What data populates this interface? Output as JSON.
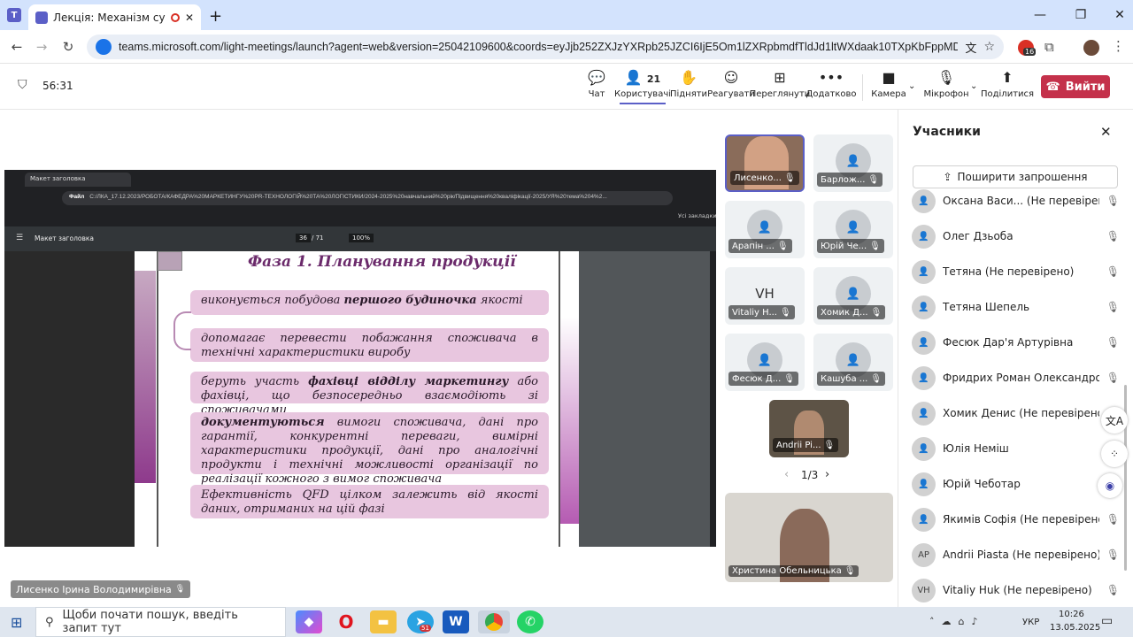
{
  "browser": {
    "tab_title": "Лекція: Механізм сучасног",
    "url": "teams.microsoft.com/light-meetings/launch?agent=web&version=25042109600&coords=eyJjb252ZXJzYXRpb25JZCI6IjE5Om1lZXRpbmdfTldJd1ltWXdaak10TXpKbFppMDBZemcyTF...",
    "ext_badge": "16"
  },
  "meeting": {
    "timer": "56:31",
    "toolbar": [
      {
        "label": "Чат",
        "icon": "chat-icon"
      },
      {
        "label": "Користувачі",
        "icon": "people-icon",
        "count": "21"
      },
      {
        "label": "Підняти",
        "icon": "hand-icon"
      },
      {
        "label": "Реагувати",
        "icon": "smiley-icon"
      },
      {
        "label": "Переглянути",
        "icon": "grid-icon"
      },
      {
        "label": "Додатково",
        "icon": "more-icon"
      },
      {
        "label": "Камера",
        "icon": "camera-icon"
      },
      {
        "label": "Мікрофон",
        "icon": "mic-off-icon"
      },
      {
        "label": "Поділитися",
        "icon": "share-icon"
      }
    ],
    "leave_label": "Вийти",
    "presenter_label": "Лисенко Ірина Володимирівна"
  },
  "pdf": {
    "tab_title": "Макет заголовка",
    "file_chip": "Файл",
    "path": "C:/ЛКА_17.12.2023/РОБОТА/КАФЕДРА%20МАРКЕТИНГУ%20PR-ТЕХНОЛОГІЙ%20ТА%20ЛОГІСТИКИ/2024-2025%20навчальний%20рік/Підвищення%20кваліфікації-2025/УЯ%20тема%204%2...",
    "bookmarks": "Усі закладки",
    "doc_title": "Макет заголовка",
    "page_current": "36",
    "page_total": "/ 71",
    "zoom": "100%",
    "slide_title": "Фаза 1. Планування продукції",
    "items": [
      {
        "pre": "виконується побудова ",
        "bold": "першого будиночка",
        "post": " якості"
      },
      {
        "pre": "допомагає перевести побажання споживача в технічні характеристики виробу",
        "bold": "",
        "post": ""
      },
      {
        "pre": "беруть участь ",
        "bold": "фахівці відділу маркетингу",
        "post": " або фахівці, що безпосередньо взаємодіють зі споживачами"
      },
      {
        "pre": "",
        "bold": "документуються",
        "post": " вимоги споживача, дані про гарантії, конкурентні переваги, вимірні характеристики продукції, дані про аналогічні продукти і технічні можливості організації по реалізації кожного з вимог споживача"
      },
      {
        "pre": "Ефективність QFD цілком залежить від якості даних, отриманих на цій фазі",
        "bold": "",
        "post": ""
      }
    ]
  },
  "gallery": {
    "tiles": [
      {
        "name": "Лисенко...",
        "initials": ""
      },
      {
        "name": "Барлож...",
        "initials": ""
      },
      {
        "name": "Арапін ...",
        "initials": ""
      },
      {
        "name": "Юрій Че...",
        "initials": ""
      },
      {
        "name": "Vitaliy H...",
        "initials": "VH"
      },
      {
        "name": "Хомик Д...",
        "initials": ""
      },
      {
        "name": "Фесюк Д...",
        "initials": ""
      },
      {
        "name": "Кашуба ...",
        "initials": ""
      },
      {
        "name": "Andrii Pi...",
        "initials": ""
      }
    ],
    "pager": "1/3",
    "self_name": "Христина Обельницька"
  },
  "participants": {
    "title": "Учасники",
    "invite_label": "Поширити запрошення",
    "list": [
      {
        "name": "Оксана Васи...  (Не перевірено)",
        "initials": ""
      },
      {
        "name": "Олег Дзьоба",
        "initials": ""
      },
      {
        "name": "Тетяна (Не перевірено)",
        "initials": ""
      },
      {
        "name": "Тетяна Шепель",
        "initials": ""
      },
      {
        "name": "Фесюк Дар'я Артурівна",
        "initials": ""
      },
      {
        "name": "Фридрих Роман Олександров...",
        "initials": ""
      },
      {
        "name": "Хомик Денис (Не перевірено)",
        "initials": ""
      },
      {
        "name": "Юлія Неміш",
        "initials": ""
      },
      {
        "name": "Юрій Чеботар",
        "initials": ""
      },
      {
        "name": "Якимів Софія (Не перевірено)",
        "initials": ""
      },
      {
        "name": "Andrii Piasta (Не перевірено)",
        "initials": "AP"
      },
      {
        "name": "Vitaliy Huk (Не перевірено)",
        "initials": "VH"
      }
    ]
  },
  "taskbar": {
    "search_placeholder": "Щоби почати пошук, введіть запит тут",
    "telegram_badge": "51",
    "lang": "УКР",
    "time": "10:26",
    "date": "13.05.2025"
  },
  "colors": {
    "accent": "#5b5fc7",
    "leave": "#c4314b",
    "slide_purple": "#8e3a8c"
  }
}
